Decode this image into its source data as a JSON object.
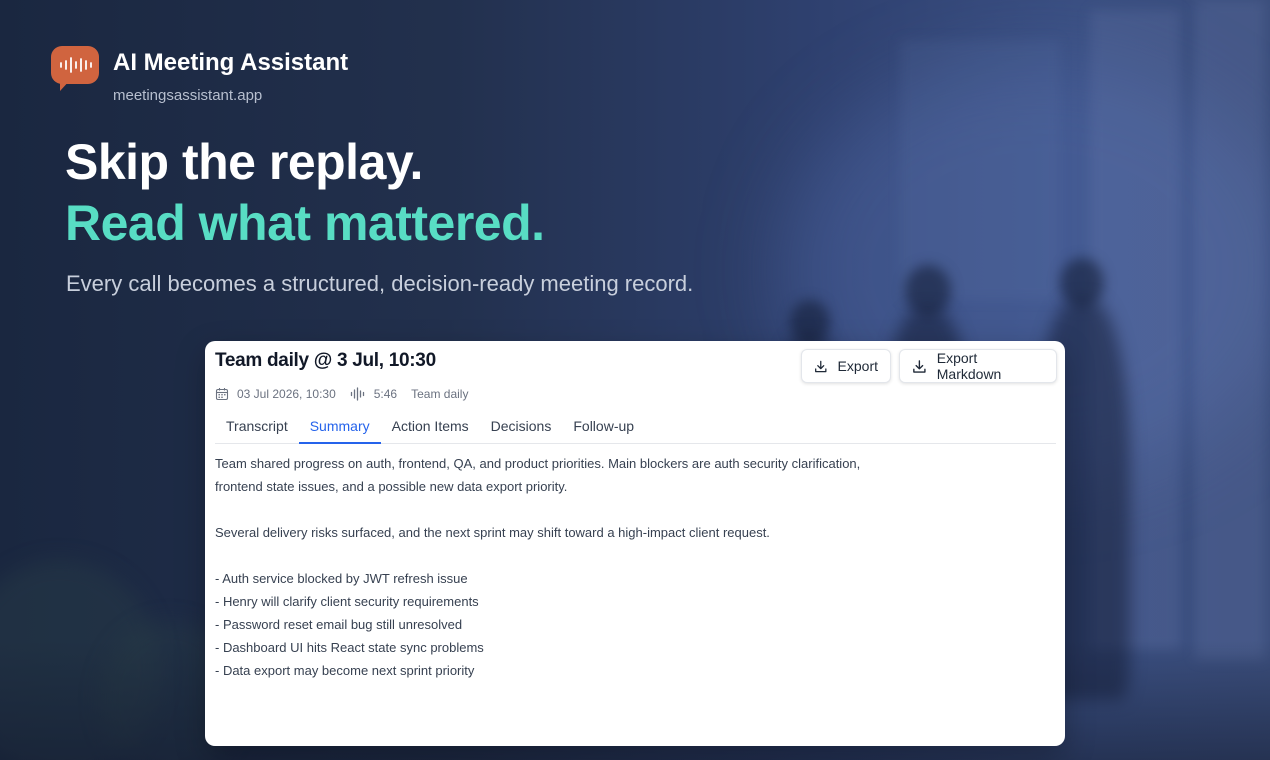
{
  "brand": {
    "title": "AI Meeting Assistant",
    "url": "meetingsassistant.app",
    "logo_icon": "speech-waveform-icon",
    "logo_color": "#d0643f"
  },
  "hero": {
    "line1": "Skip the replay.",
    "line2": "Read what mattered.",
    "subtitle": "Every call becomes a structured, decision-ready meeting record.",
    "accent_color": "#58ddc4"
  },
  "meeting": {
    "title": "Team daily @ 3 Jul, 10:30",
    "date": "03 Jul 2026, 10:30",
    "duration": "5:46",
    "series": "Team daily",
    "actions": {
      "export": "Export",
      "export_markdown": "Export Markdown"
    },
    "tabs": [
      "Transcript",
      "Summary",
      "Action Items",
      "Decisions",
      "Follow-up"
    ],
    "active_tab": "Summary",
    "summary": {
      "p1_line1": "Team shared progress on auth, frontend, QA, and product priorities. Main blockers are auth security clarification,",
      "p1_line2": "frontend state issues, and a possible new data export priority.",
      "p2": "Several delivery risks surfaced, and the next sprint may shift toward a high-impact client request.",
      "bullets": [
        "- Auth service blocked by JWT refresh issue",
        "- Henry will clarify client security requirements",
        "- Password reset email bug still unresolved",
        "- Dashboard UI hits React state sync problems",
        "- Data export may become next sprint priority"
      ]
    }
  }
}
